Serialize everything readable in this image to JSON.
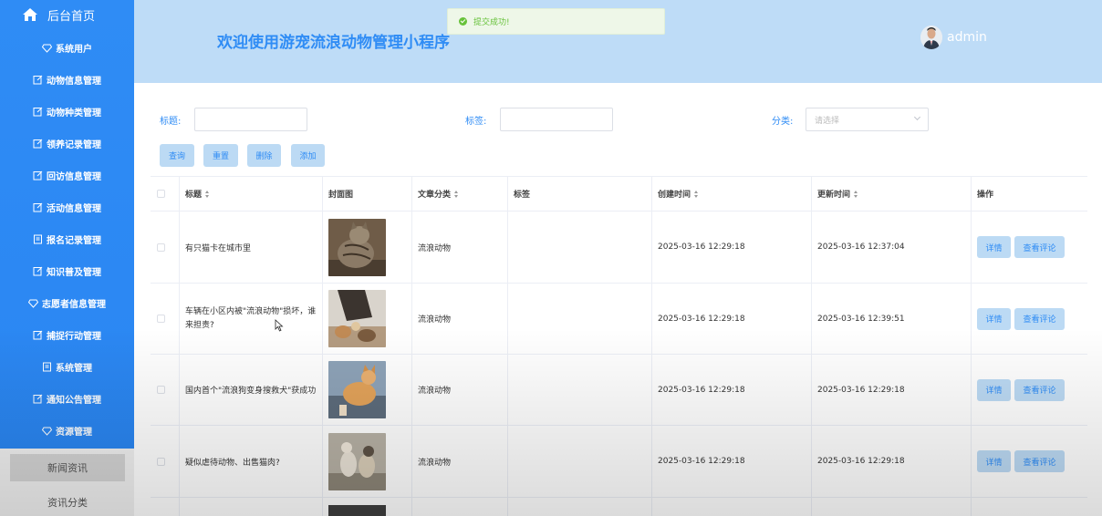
{
  "sidebar": {
    "home_label": "后台首页",
    "items": [
      {
        "label": "系统用户",
        "icon": "diamond-icon"
      },
      {
        "label": "动物信息管理",
        "icon": "edit-icon"
      },
      {
        "label": "动物种类管理",
        "icon": "edit-icon"
      },
      {
        "label": "领养记录管理",
        "icon": "edit-icon"
      },
      {
        "label": "回访信息管理",
        "icon": "edit-icon"
      },
      {
        "label": "活动信息管理",
        "icon": "edit-icon"
      },
      {
        "label": "报名记录管理",
        "icon": "document-icon"
      },
      {
        "label": "知识普及管理",
        "icon": "edit-icon"
      },
      {
        "label": "志愿者信息管理",
        "icon": "diamond-icon"
      },
      {
        "label": "捕捉行动管理",
        "icon": "edit-icon"
      },
      {
        "label": "系统管理",
        "icon": "document-icon"
      },
      {
        "label": "通知公告管理",
        "icon": "edit-icon"
      },
      {
        "label": "资源管理",
        "icon": "diamond-icon"
      }
    ],
    "sub_items": [
      {
        "label": "新闻资讯",
        "active": true
      },
      {
        "label": "资讯分类",
        "active": false
      }
    ]
  },
  "header": {
    "title": "欢迎使用游宠流浪动物管理小程序",
    "user": "admin"
  },
  "toast": {
    "text": "提交成功!"
  },
  "search": {
    "title_label": "标题:",
    "tag_label": "标签:",
    "category_label": "分类:",
    "category_placeholder": "请选择",
    "buttons": {
      "query": "查询",
      "reset": "重置",
      "delete": "删除",
      "add": "添加"
    }
  },
  "table": {
    "headers": {
      "title": "标题",
      "cover": "封面图",
      "category": "文章分类",
      "tag": "标签",
      "created": "创建时间",
      "updated": "更新时间",
      "actions": "操作"
    },
    "rows": [
      {
        "title": "有只猫卡在城市里",
        "category": "流浪动物",
        "tag": "",
        "created": "2025-03-16 12:29:18",
        "updated": "2025-03-16 12:37:04"
      },
      {
        "title": "车辆在小区内被\"流浪动物\"损坏，谁来担责?",
        "category": "流浪动物",
        "tag": "",
        "created": "2025-03-16 12:29:18",
        "updated": "2025-03-16 12:39:51"
      },
      {
        "title": "国内首个\"流浪狗变身搜救犬\"获成功",
        "category": "流浪动物",
        "tag": "",
        "created": "2025-03-16 12:29:18",
        "updated": "2025-03-16 12:29:18"
      },
      {
        "title": "疑似虐待动物、出售猫肉?",
        "category": "流浪动物",
        "tag": "",
        "created": "2025-03-16 12:29:18",
        "updated": "2025-03-16 12:29:18"
      }
    ],
    "row_buttons": {
      "detail": "详情",
      "comments": "查看评论"
    }
  },
  "colors": {
    "primary": "#2f8cf5",
    "header_bg": "#bedcf7",
    "button_bg": "#bcdaf4",
    "success": "#67c23a"
  }
}
